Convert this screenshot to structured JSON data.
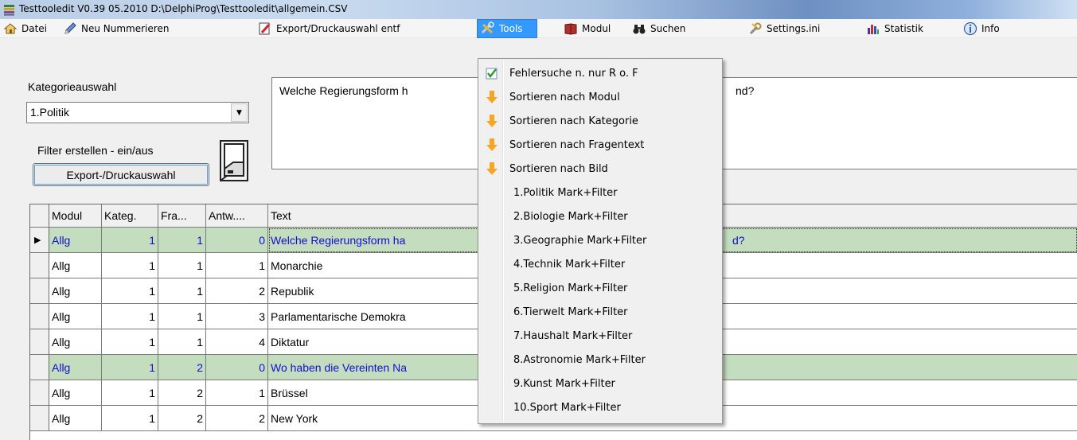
{
  "window": {
    "title": "Testtooledit V0.39 05.2010 D:\\DelphiProg\\Testtooledit\\allgemein.CSV"
  },
  "menubar": [
    {
      "label": "Datei",
      "icon": "home-icon"
    },
    {
      "label": "Neu Nummerieren",
      "icon": "pencil-icon"
    },
    {
      "label": "Export/Druckauswahl entf",
      "icon": "export-icon"
    },
    {
      "label": "Tools",
      "icon": "tools-icon"
    },
    {
      "label": "Modul",
      "icon": "book-icon"
    },
    {
      "label": "Suchen",
      "icon": "binoculars-icon"
    },
    {
      "label": "Settings.ini",
      "icon": "wrench-icon"
    },
    {
      "label": "Statistik",
      "icon": "chart-icon"
    },
    {
      "label": "Info",
      "icon": "info-icon"
    }
  ],
  "left": {
    "category_label": "Kategorieauswahl",
    "category_value": "1.Politik",
    "filter_label": "Filter erstellen - ein/aus",
    "export_button": "Export-/Druckauswahl"
  },
  "question_text": "Welche Regierungsform h",
  "question_tail": "nd?",
  "grid": {
    "headers": [
      "Modul",
      "Kateg.",
      "Fra...",
      "Antw....",
      "Text"
    ],
    "rows": [
      [
        "Allg",
        "1",
        "1",
        "0",
        "Welche Regierungsform ha",
        "d?"
      ],
      [
        "Allg",
        "1",
        "1",
        "1",
        "Monarchie",
        ""
      ],
      [
        "Allg",
        "1",
        "1",
        "2",
        "Republik",
        ""
      ],
      [
        "Allg",
        "1",
        "1",
        "3",
        "Parlamentarische Demokra",
        ""
      ],
      [
        "Allg",
        "1",
        "1",
        "4",
        "Diktatur",
        ""
      ],
      [
        "Allg",
        "1",
        "2",
        "0",
        "Wo haben die Vereinten Na",
        ""
      ],
      [
        "Allg",
        "1",
        "2",
        "1",
        "Brüssel",
        ""
      ],
      [
        "Allg",
        "1",
        "2",
        "2",
        "New York",
        ""
      ]
    ]
  },
  "tools_menu": [
    {
      "label": "Fehlersuche n. nur R o. F",
      "icon": "check-icon"
    },
    {
      "label": "Sortieren nach Modul",
      "icon": "arrow-down-icon"
    },
    {
      "label": "Sortieren nach Kategorie",
      "icon": "arrow-down-icon"
    },
    {
      "label": "Sortieren nach Fragentext",
      "icon": "arrow-down-icon"
    },
    {
      "label": "Sortieren nach Bild",
      "icon": "arrow-down-icon"
    },
    {
      "label": "1.Politik Mark+Filter"
    },
    {
      "label": "2.Biologie Mark+Filter"
    },
    {
      "label": "3.Geographie Mark+Filter"
    },
    {
      "label": "4.Technik Mark+Filter"
    },
    {
      "label": "5.Religion Mark+Filter"
    },
    {
      "label": "6.Tierwelt Mark+Filter"
    },
    {
      "label": "7.Haushalt Mark+Filter"
    },
    {
      "label": "8.Astronomie Mark+Filter"
    },
    {
      "label": "9.Kunst Mark+Filter"
    },
    {
      "label": "10.Sport Mark+Filter"
    }
  ],
  "colors": {
    "menu_highlight": "#3399ff",
    "question_row": "#c4ddbf",
    "question_text": "#1010d0",
    "sort_arrow": "#f6a623"
  }
}
